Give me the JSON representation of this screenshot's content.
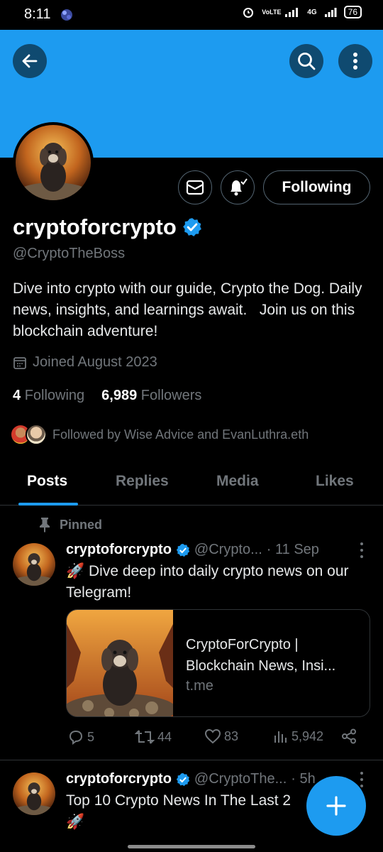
{
  "status_bar": {
    "time": "8:11",
    "network": "4G",
    "volte": "VoLTE",
    "battery": "76"
  },
  "colors": {
    "accent": "#1d9bf0",
    "background": "#000000",
    "secondary_text": "#71767b",
    "border": "#2f3336"
  },
  "header": {
    "back_icon": "arrow-left-icon",
    "search_icon": "search-icon",
    "more_icon": "more-vertical-icon"
  },
  "profile": {
    "display_name": "cryptoforcrypto",
    "verified": true,
    "handle": "@CryptoTheBoss",
    "bio": "Dive into crypto with our guide, Crypto the Dog. Daily news, insights, and learnings await.   Join us on this blockchain adventure!",
    "joined": "Joined August 2023",
    "following_count": "4",
    "following_label": "Following",
    "followers_count": "6,989",
    "followers_label": "Followers",
    "followed_by": "Followed by Wise Advice and EvanLuthra.eth",
    "follow_button_label": "Following"
  },
  "tabs": [
    {
      "label": "Posts",
      "active": true
    },
    {
      "label": "Replies",
      "active": false
    },
    {
      "label": "Media",
      "active": false
    },
    {
      "label": "Likes",
      "active": false
    }
  ],
  "posts": [
    {
      "pinned_label": "Pinned",
      "name": "cryptoforcrypto",
      "handle": "@Crypto...",
      "time": "· 11 Sep",
      "text": "🚀 Dive deep into daily crypto news on our Telegram!",
      "card": {
        "title": "CryptoForCrypto | Blockchain News, Insi...",
        "domain": "t.me"
      },
      "replies": "5",
      "reposts": "44",
      "likes": "83",
      "views": "5,942"
    },
    {
      "name": "cryptoforcrypto",
      "handle": "@CryptoThe...",
      "time": "· 5h",
      "text": "Top 10 Crypto News In The Last 2",
      "text2": "🚀"
    }
  ]
}
